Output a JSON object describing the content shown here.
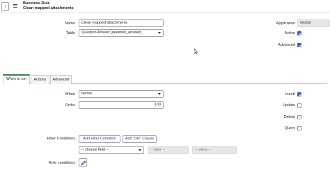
{
  "header": {
    "back_icon": "back-icon",
    "menu_icon": "hamburger-icon",
    "title": "Business Rule",
    "subtitle": "Clean mapped attachments"
  },
  "form": {
    "name_label": "Name",
    "name_value": "Clean mapped attachments",
    "table_label": "Table",
    "table_value": "Question Answer [question_answer]",
    "application_label": "Application",
    "application_value": "Global",
    "active_label": "Active",
    "active_checked": true,
    "advanced_label": "Advanced",
    "advanced_checked": true
  },
  "tabs": [
    {
      "label": "When to run",
      "active": true
    },
    {
      "label": "Actions",
      "active": false
    },
    {
      "label": "Advanced",
      "active": false
    }
  ],
  "when_to_run": {
    "when_label": "When",
    "when_value": "before",
    "order_label": "Order",
    "order_value": "100",
    "insert_label": "Insert",
    "insert_checked": true,
    "update_label": "Update",
    "update_checked": false,
    "delete_label": "Delete",
    "delete_checked": false,
    "query_label": "Query",
    "query_checked": false,
    "filter_conditions_label": "Filter Conditions",
    "add_filter_condition_label": "Add Filter Condition",
    "add_or_clause_label": "Add \"OR\" Clause",
    "choose_field_placeholder": "-- choose field --",
    "oper_placeholder": "-- oper --",
    "value_placeholder": "-- value --",
    "role_conditions_label": "Role conditions",
    "role_edit_icon": "pencil-icon"
  },
  "colors": {
    "accent": "#3b5bcc",
    "active_tab": "#2e8540",
    "button_text": "#2b3a8f"
  }
}
